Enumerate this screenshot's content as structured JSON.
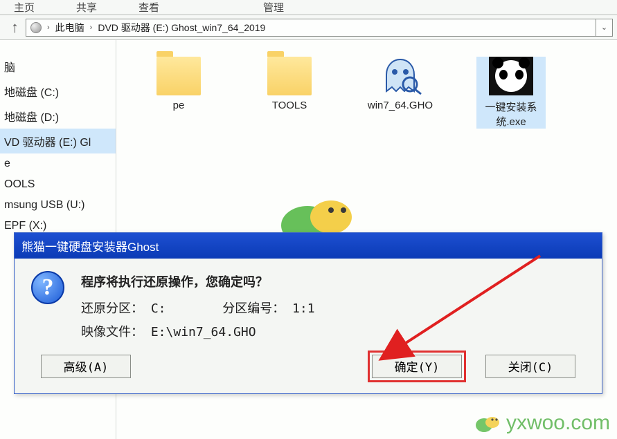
{
  "ribbon": {
    "tab_home": "主页",
    "tab_share": "共享",
    "tab_view": "查看",
    "tab_manage": "管理"
  },
  "address": {
    "crumb1": "此电脑",
    "crumb2": "DVD 驱动器 (E:) Ghost_win7_64_2019"
  },
  "sidebar": {
    "items": [
      "脑",
      "地磁盘 (C:)",
      "地磁盘 (D:)",
      "VD 驱动器 (E:) Gl",
      "e",
      "OOLS",
      "msung USB (U:)",
      "EPF (X:)"
    ],
    "selected_index": 3
  },
  "files": [
    {
      "name": "pe",
      "type": "folder"
    },
    {
      "name": "TOOLS",
      "type": "folder"
    },
    {
      "name": "win7_64.GHO",
      "type": "gho"
    },
    {
      "name": "一键安装系统.exe",
      "type": "exe",
      "selected": true
    }
  ],
  "dialog": {
    "title": "熊猫一键硬盘安装器Ghost",
    "message": "程序将执行还原操作，您确定吗？",
    "restore_label": "还原分区：",
    "restore_value": "C:",
    "partnum_label": "分区编号：",
    "partnum_value": "1:1",
    "image_label": "映像文件：",
    "image_value": "E:\\win7_64.GHO",
    "btn_advanced": "高级(A)",
    "btn_ok": "确定(Y)",
    "btn_close": "关闭(C)"
  },
  "watermark": "yxwoo.com"
}
